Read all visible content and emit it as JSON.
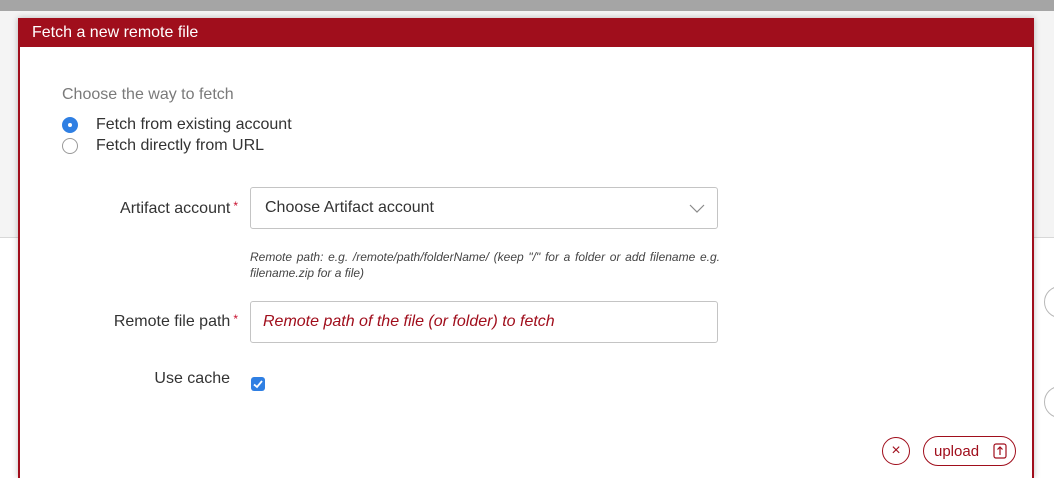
{
  "dialog": {
    "title": "Fetch a new remote file",
    "fetch_way_label": "Choose the way to fetch",
    "options": [
      {
        "label": "Fetch from existing account",
        "selected": true
      },
      {
        "label": "Fetch directly from URL",
        "selected": false
      }
    ],
    "artifact_account": {
      "label": "Artifact account",
      "required_mark": "*",
      "value": "Choose Artifact account"
    },
    "hint": "Remote path: e.g. /remote/path/folderName/ (keep \"/\" for a folder or add filename e.g. filename.zip for a file)",
    "remote_path": {
      "label": "Remote file path",
      "required_mark": "*",
      "placeholder": "Remote path of the file (or folder) to fetch",
      "value": ""
    },
    "use_cache": {
      "label": "Use cache",
      "checked": true
    },
    "cancel_glyph": "×",
    "upload_label": "upload"
  },
  "colors": {
    "brand": "#a00e1c",
    "accent": "#2f7fe3"
  },
  "icons": {
    "chevron": "chevron-down-icon",
    "cancel": "close-icon",
    "upload": "upload-icon"
  }
}
